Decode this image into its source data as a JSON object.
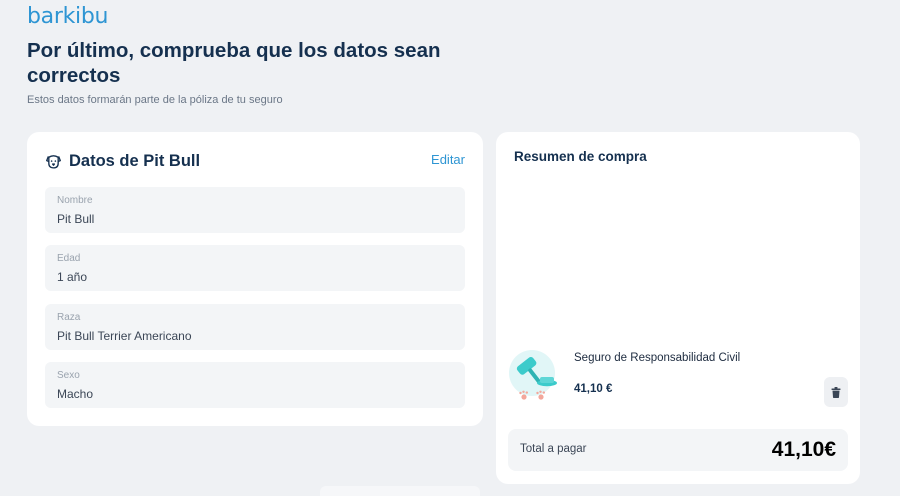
{
  "brand": {
    "logo": "barkibu"
  },
  "header": {
    "title": "Por último, comprueba que los datos sean correctos",
    "subtitle": "Estos datos formarán parte de la póliza de tu seguro"
  },
  "pet_card": {
    "title": "Datos de Pit Bull",
    "edit_label": "Editar",
    "icon": "dog-face-icon",
    "fields": [
      {
        "label": "Nombre",
        "value": "Pit Bull"
      },
      {
        "label": "Edad",
        "value": "1 año"
      },
      {
        "label": "Raza",
        "value": "Pit Bull Terrier Americano"
      },
      {
        "label": "Sexo",
        "value": "Macho"
      }
    ]
  },
  "summary": {
    "title": "Resumen de compra",
    "product": {
      "name": "Seguro de Responsabilidad Civil",
      "price": "41,10 €",
      "icon": "gavel-paws-icon"
    },
    "delete_icon": "trash-icon",
    "total_label": "Total a pagar",
    "total_value": "41,10€"
  },
  "colors": {
    "brand": "#2e95d3",
    "title": "#15304f",
    "background": "#eff1f4",
    "field_bg": "#f3f5f7",
    "accent_teal": "#3ccbcb"
  }
}
